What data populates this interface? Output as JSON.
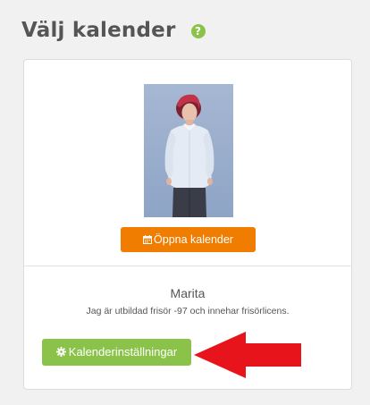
{
  "page": {
    "title": "Välj kalender",
    "help_icon_glyph": "?"
  },
  "card": {
    "photo_icon": "profile-photo",
    "open_calendar_label": "Öppna kalender",
    "open_calendar_icon": "calendar-icon",
    "name": "Marita",
    "bio": "Jag är utbildad frisör -97 och innehar frisörlicens.",
    "settings_label": "Kalenderinställningar",
    "settings_icon": "gear-icon"
  },
  "annotation": {
    "arrow_icon": "red-arrow-left-icon"
  },
  "colors": {
    "background": "#f1f1f1",
    "accent_green": "#8bc34a",
    "accent_orange": "#f07c00",
    "arrow_red": "#e8141c",
    "text": "#555555"
  }
}
